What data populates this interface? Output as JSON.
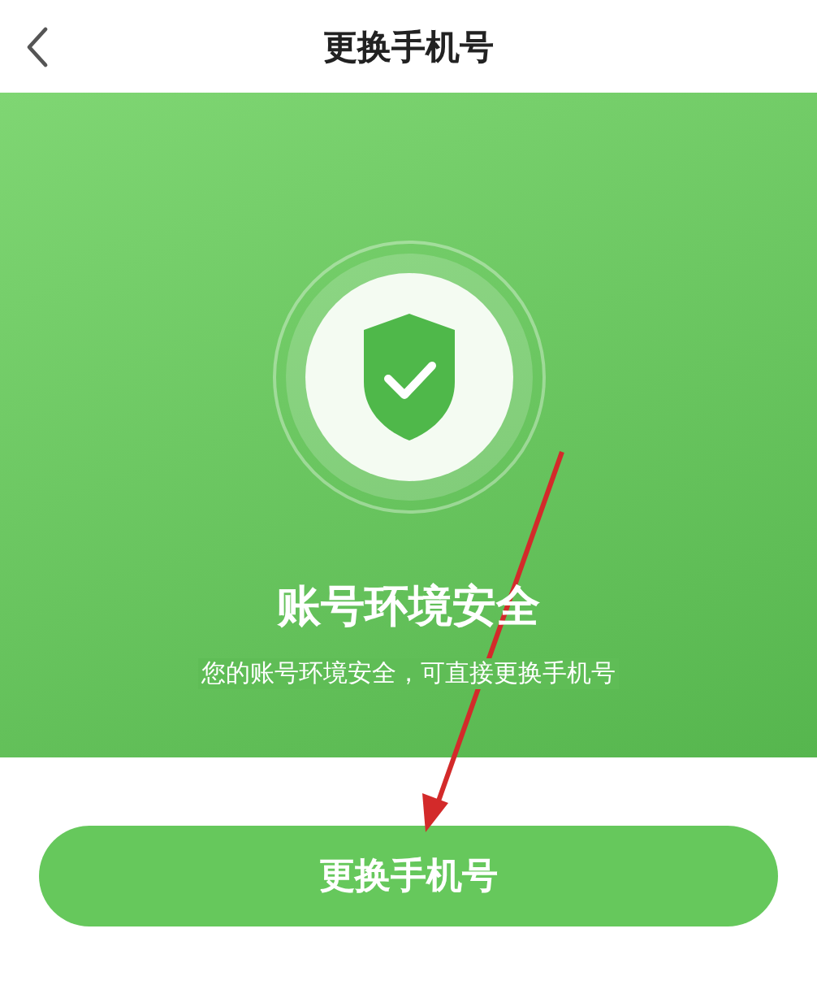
{
  "header": {
    "title": "更换手机号"
  },
  "banner": {
    "title": "账号环境安全",
    "subtitle": "您的账号环境安全，可直接更换手机号"
  },
  "button": {
    "label": "更换手机号"
  }
}
